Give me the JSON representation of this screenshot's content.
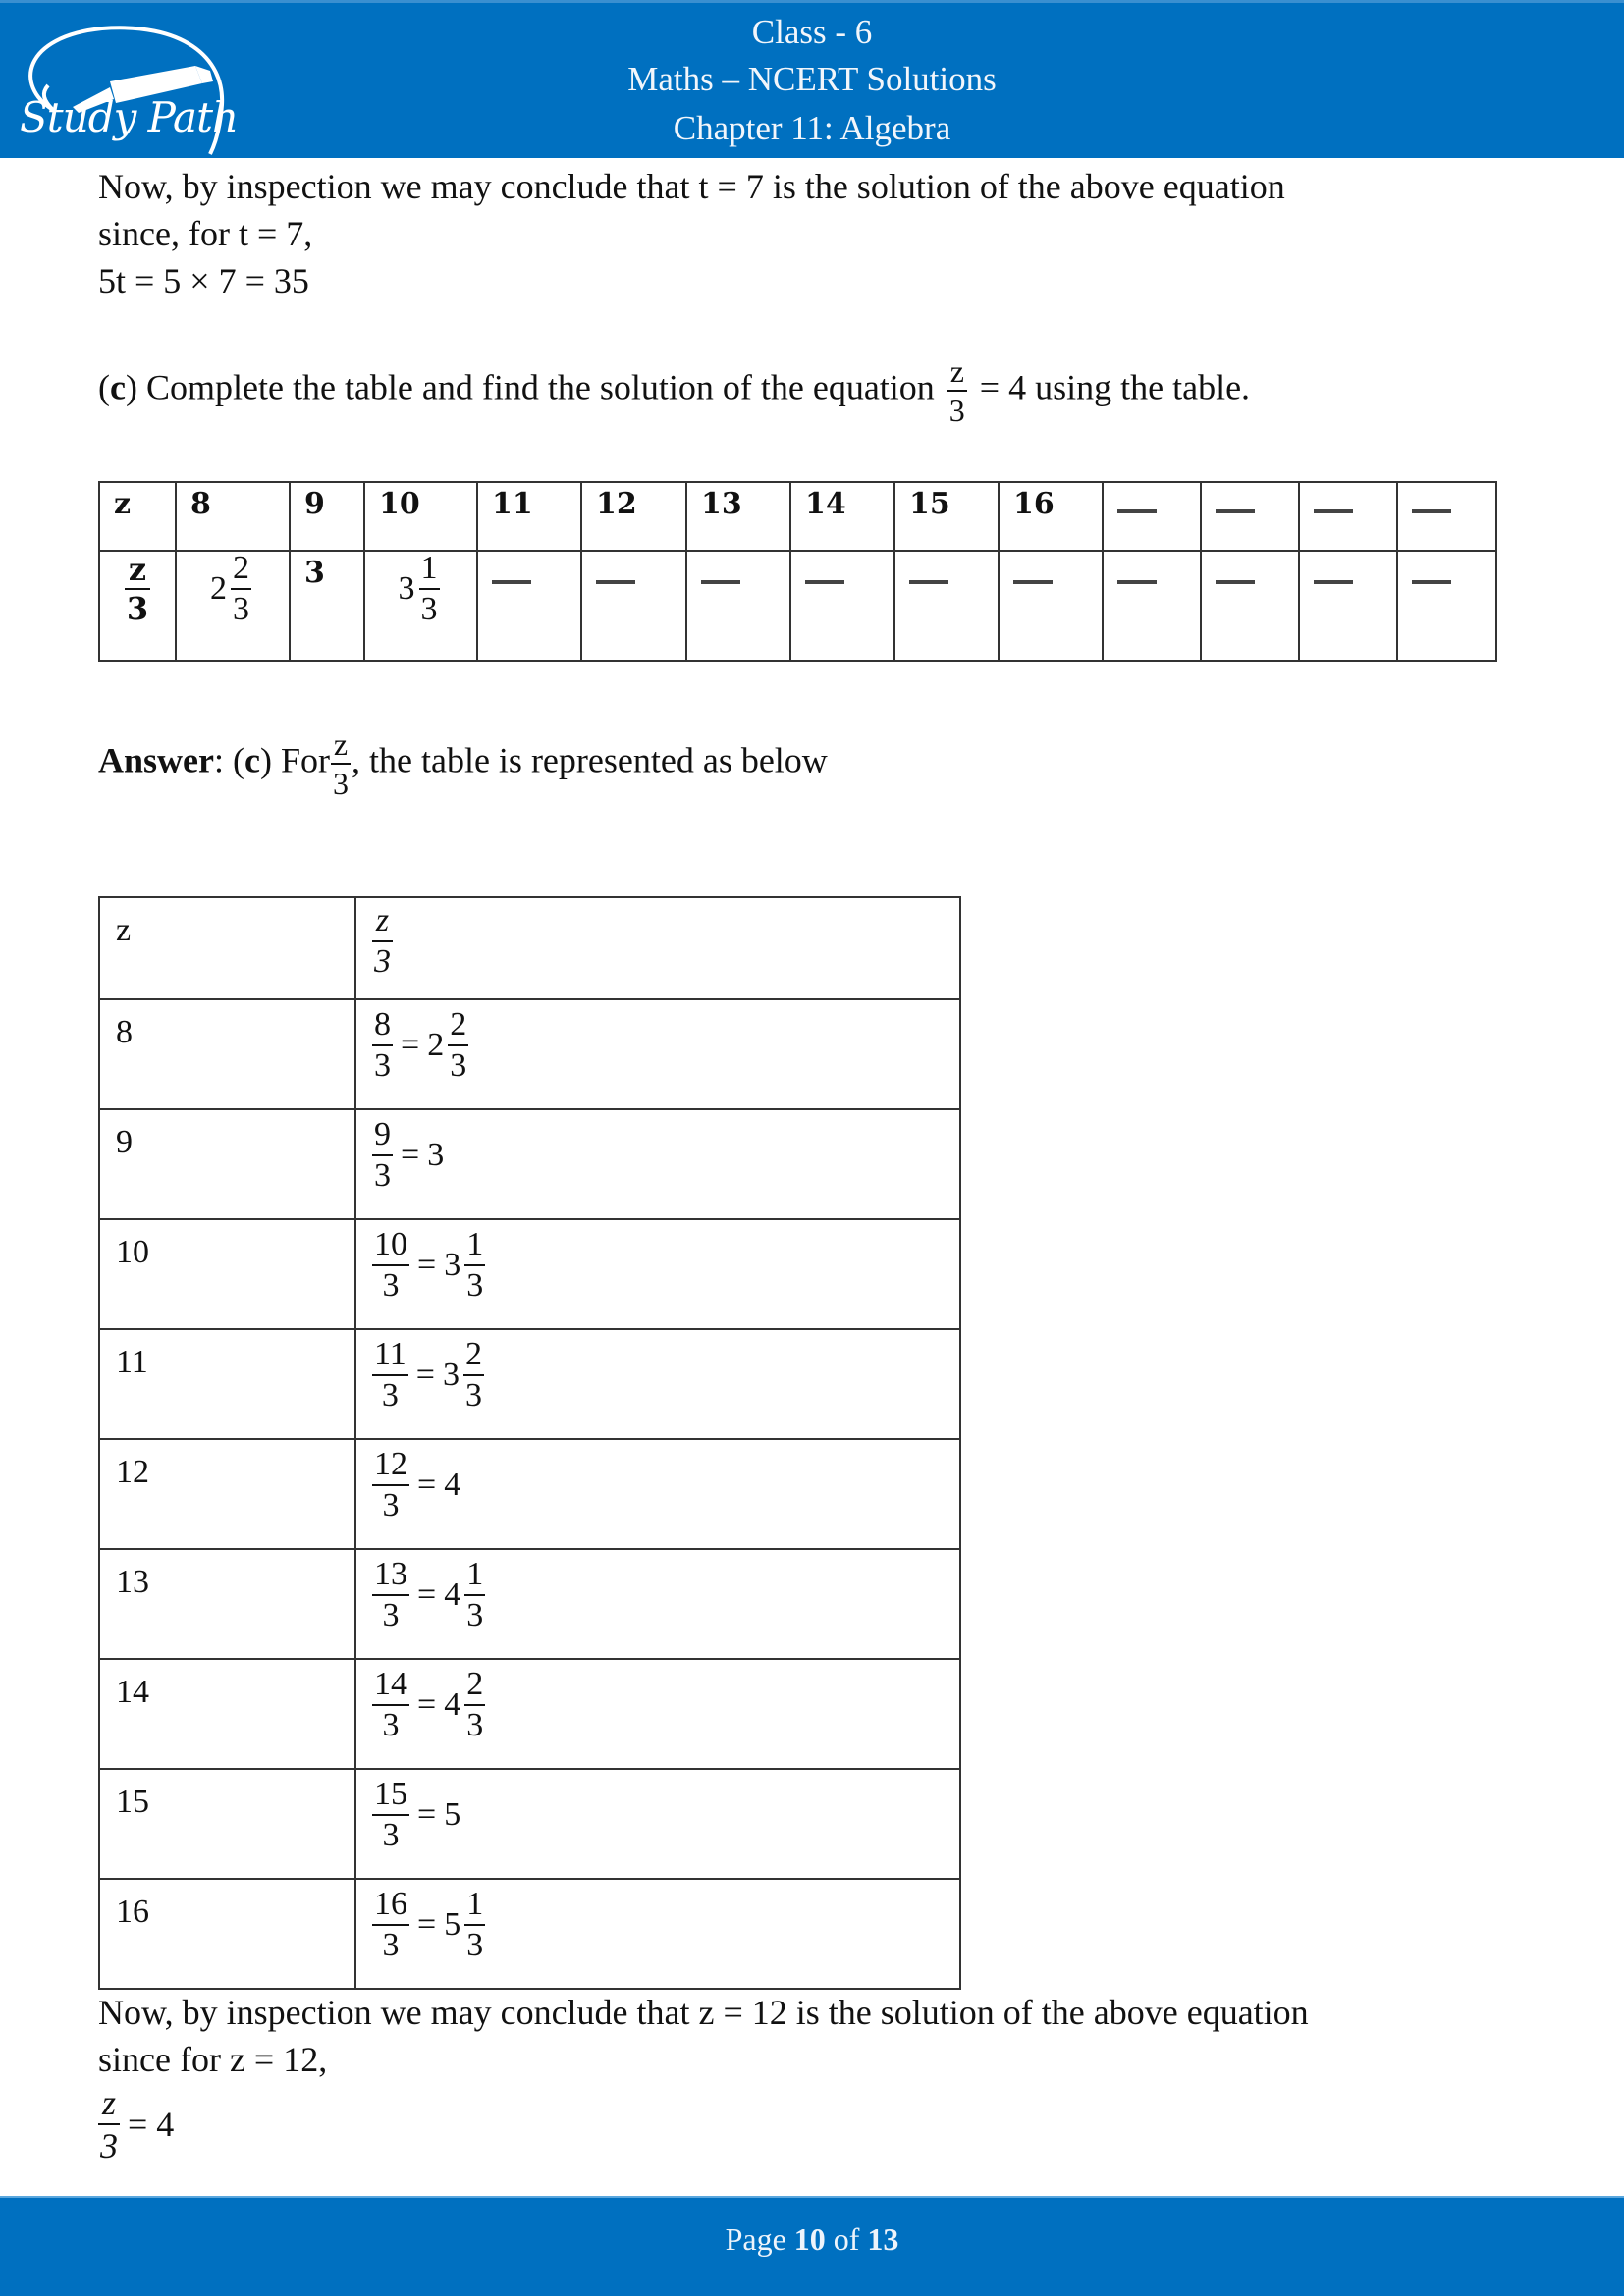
{
  "header": {
    "logo_text": "Study Path",
    "line1": "Class - 6",
    "line2": "Maths – NCERT Solutions",
    "line3": "Chapter 11: Algebra",
    "color": "#0070C0"
  },
  "intro": {
    "line1": "Now, by inspection we may conclude that t = 7 is the solution of the above equation",
    "line2": "since, for t = 7,",
    "line3": "5t  =  5 × 7  =  35"
  },
  "question": {
    "label": "c",
    "text_before": "Complete the table and find the solution of the equation",
    "frac_num": "z",
    "frac_den": "3",
    "text_after": "= 4 using the table."
  },
  "question_table": {
    "row1_header": "z",
    "row1": [
      "8",
      "9",
      "10",
      "11",
      "12",
      "13",
      "14",
      "15",
      "16",
      "—",
      "—",
      "—",
      "—"
    ],
    "row2_header_num": "z",
    "row2_header_den": "3",
    "row2": [
      {
        "whole": "2",
        "num": "2",
        "den": "3"
      },
      {
        "whole": "3"
      },
      {
        "whole": "3",
        "num": "1",
        "den": "3"
      },
      {
        "whole": "—"
      },
      {
        "whole": "—"
      },
      {
        "whole": "—"
      },
      {
        "whole": "—"
      },
      {
        "whole": "—"
      },
      {
        "whole": "—"
      },
      {
        "whole": "—"
      },
      {
        "whole": "—"
      },
      {
        "whole": "—"
      },
      {
        "whole": "—"
      }
    ]
  },
  "answer": {
    "label": "Answer",
    "part": "c",
    "for_text": "For",
    "frac_num": "z",
    "frac_den": "3",
    "rest": ", the table is represented as below"
  },
  "answer_table": {
    "col1_header": "z",
    "col2_header_num": "z",
    "col2_header_den": "3",
    "rows": [
      {
        "z": "8",
        "num": "8",
        "den": "3",
        "whole": "2",
        "fnum": "2",
        "fden": "3"
      },
      {
        "z": "9",
        "num": "9",
        "den": "3",
        "whole": "3",
        "fnum": "",
        "fden": ""
      },
      {
        "z": "10",
        "num": "10",
        "den": "3",
        "whole": "3",
        "fnum": "1",
        "fden": "3"
      },
      {
        "z": "11",
        "num": "11",
        "den": "3",
        "whole": "3",
        "fnum": "2",
        "fden": "3"
      },
      {
        "z": "12",
        "num": "12",
        "den": "3",
        "whole": "4",
        "fnum": "",
        "fden": ""
      },
      {
        "z": "13",
        "num": "13",
        "den": "3",
        "whole": "4",
        "fnum": "1",
        "fden": "3"
      },
      {
        "z": "14",
        "num": "14",
        "den": "3",
        "whole": "4",
        "fnum": "2",
        "fden": "3"
      },
      {
        "z": "15",
        "num": "15",
        "den": "3",
        "whole": "5",
        "fnum": "",
        "fden": ""
      },
      {
        "z": "16",
        "num": "16",
        "den": "3",
        "whole": "5",
        "fnum": "1",
        "fden": "3"
      }
    ]
  },
  "conclusion": {
    "line1": "Now, by inspection we may conclude that z = 12 is the solution of the above equation",
    "line2": "since for z = 12,",
    "frac_num": "z",
    "frac_den": "3",
    "rhs": "= 4"
  },
  "footer": {
    "page_word": "Page",
    "current": "10",
    "of_word": "of",
    "total": "13"
  }
}
